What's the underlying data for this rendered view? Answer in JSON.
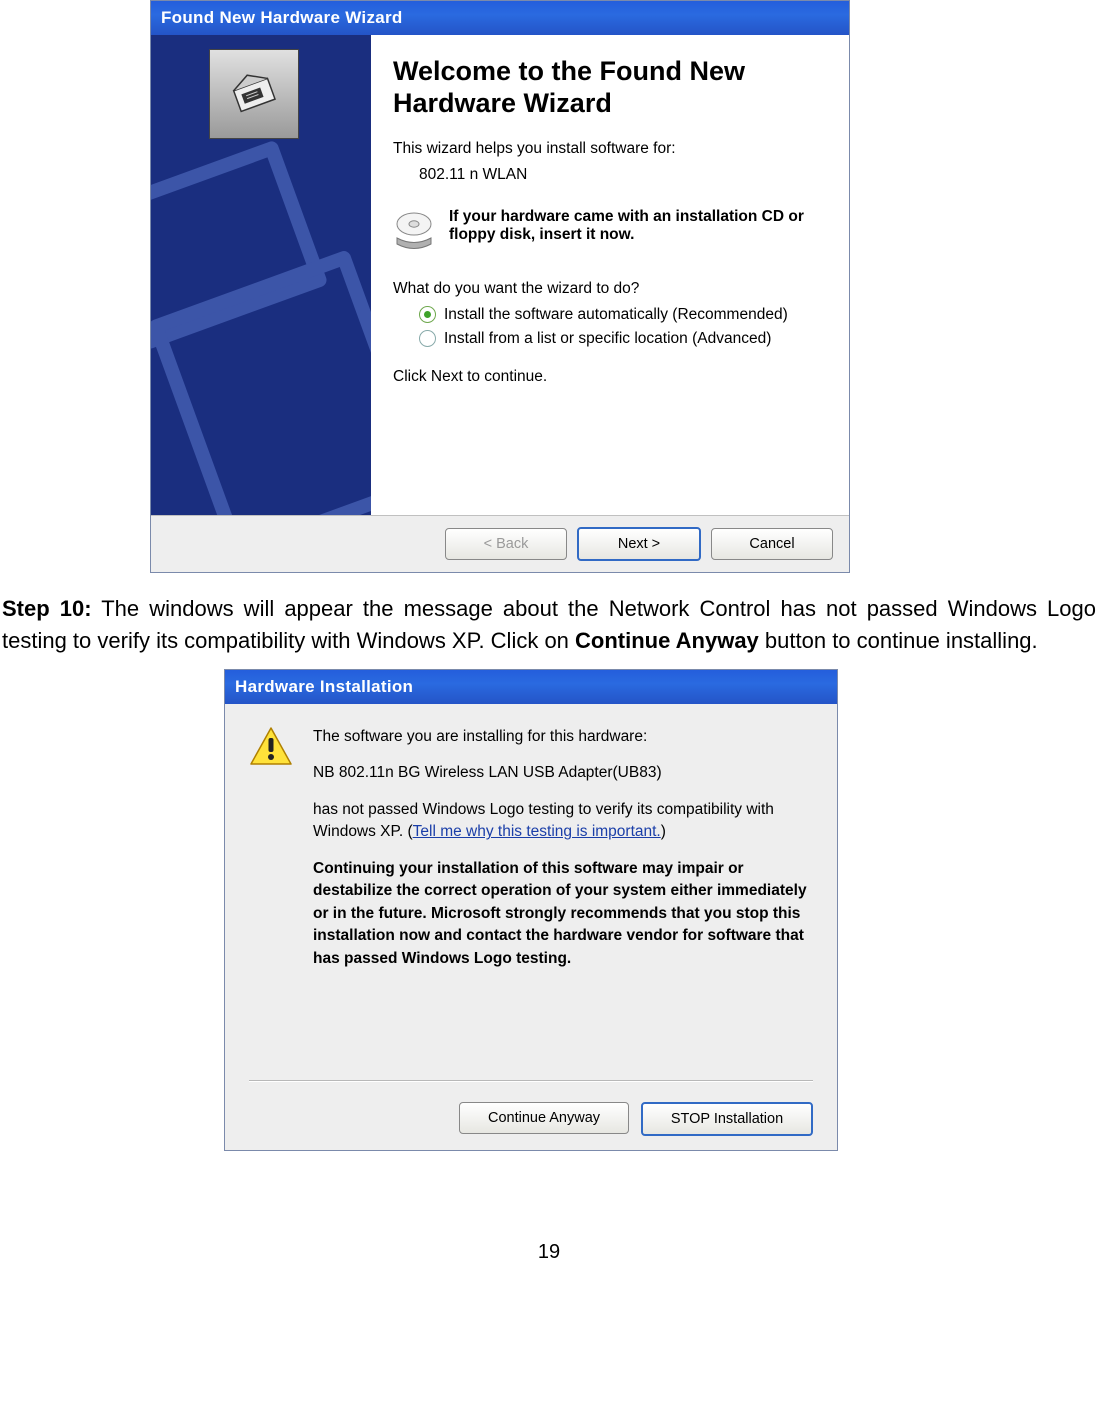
{
  "wizard": {
    "title": "Found New Hardware Wizard",
    "heading": "Welcome to the Found New Hardware Wizard",
    "intro": "This wizard helps you install software for:",
    "device": "802.11 n WLAN",
    "cd_hint": "If your hardware came with an installation CD or floppy disk, insert it now.",
    "question": "What do you want the wizard to do?",
    "option_auto": "Install the software automatically (Recommended)",
    "option_list": "Install from a list or specific location (Advanced)",
    "click_next": "Click Next to continue.",
    "btn_back": "< Back",
    "btn_next": "Next >",
    "btn_cancel": "Cancel"
  },
  "step": {
    "label": "Step 10:",
    "text_1": " The windows will appear the message about the Network Control has not passed Windows Logo testing to verify its compatibility with Windows XP. Click on ",
    "bold": "Continue Anyway",
    "text_2": " button to continue installing."
  },
  "install": {
    "title": "Hardware Installation",
    "line1": "The software you are installing for this hardware:",
    "device": "NB 802.11n BG Wireless LAN USB Adapter(UB83)",
    "line2a": "has not passed Windows Logo testing to verify its compatibility with Windows XP. (",
    "link": "Tell me why this testing is important.",
    "line2b": ")",
    "warn": "Continuing your installation of this software may impair or destabilize the correct operation of your system either immediately or in the future. Microsoft strongly recommends that you stop this installation now and contact the hardware vendor for software that has passed Windows Logo testing.",
    "btn_continue": "Continue Anyway",
    "btn_stop": "STOP Installation"
  },
  "page_number": "19"
}
